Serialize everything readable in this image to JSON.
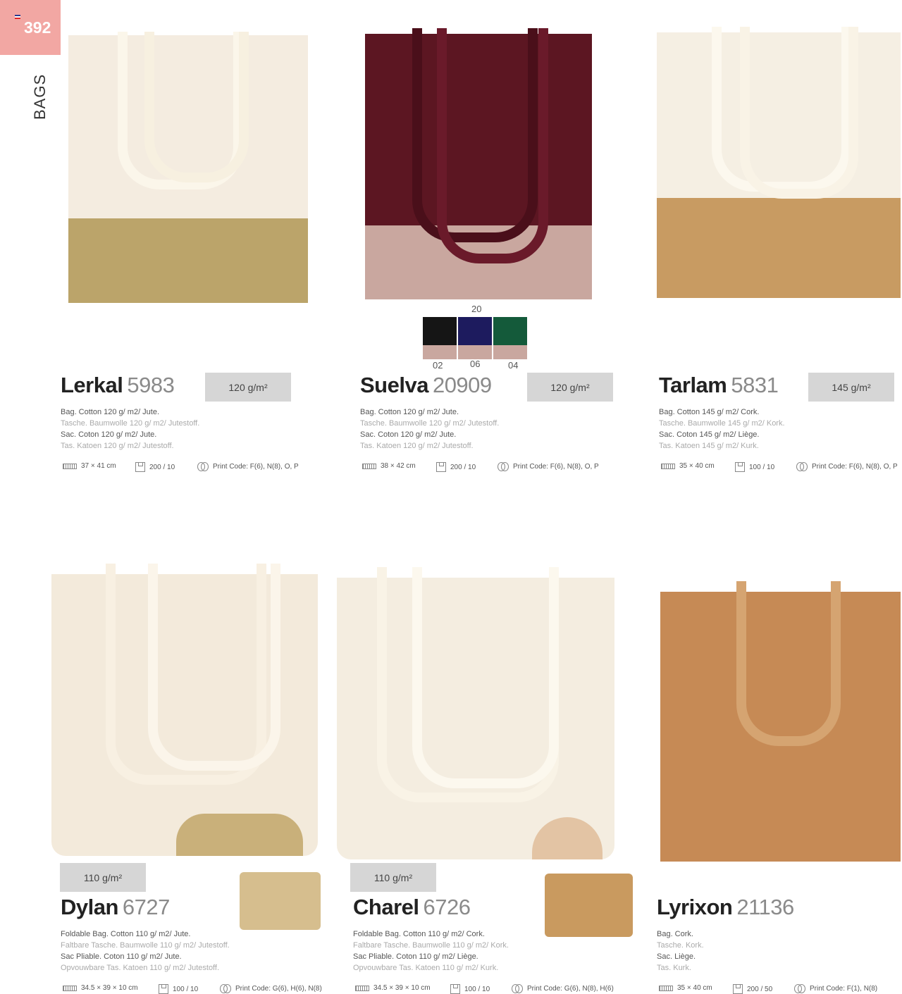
{
  "page": {
    "number": "392",
    "section": "BAGS"
  },
  "colors": {
    "badge": "#f2a7a3",
    "weight_box": "#d6d6d6"
  },
  "products": [
    {
      "name": "Lerkal",
      "code": "5983",
      "weight": "120 g/m²",
      "desc": [
        "Bag. Cotton 120 g/ m2/ Jute.",
        "Tasche. Baumwolle 120 g/ m2/ Jutestoff.",
        "Sac. Coton 120 g/ m2/ Jute.",
        "Tas. Katoen 120 g/ m2/ Jutestoff."
      ],
      "size": "37 × 41 cm",
      "pack": "200 / 10",
      "print": "Print Code: F(6), N(8), O, P"
    },
    {
      "name": "Suelva",
      "code": "20909",
      "weight": "120 g/m²",
      "desc": [
        "Bag. Cotton 120 g/ m2/ Jute.",
        "Tasche. Baumwolle 120 g/ m2/ Jutestoff.",
        "Sac. Coton 120 g/ m2/ Jute.",
        "Tas. Katoen 120 g/ m2/ Jutestoff."
      ],
      "size": "38 × 42 cm",
      "pack": "200 / 10",
      "print": "Print Code: F(6), N(8), O, P",
      "swatches": [
        {
          "code": "20",
          "color": "#5c1622"
        },
        {
          "code": "02",
          "color": "#151515"
        },
        {
          "code": "06",
          "color": "#1d1b5e"
        },
        {
          "code": "04",
          "color": "#145a3a"
        }
      ]
    },
    {
      "name": "Tarlam",
      "code": "5831",
      "weight": "145 g/m²",
      "desc": [
        "Bag. Cotton 145 g/ m2/ Cork.",
        "Tasche. Baumwolle 145 g/ m2/ Kork.",
        "Sac. Coton 145 g/ m2/ Liège.",
        "Tas. Katoen 145 g/ m2/ Kurk."
      ],
      "size": "35 × 40 cm",
      "pack": "100 / 10",
      "print": "Print Code: F(6), N(8), O, P"
    },
    {
      "name": "Dylan",
      "code": "6727",
      "weight": "110 g/m²",
      "desc": [
        "Foldable Bag. Cotton 110 g/ m2/ Jute.",
        "Faltbare Tasche. Baumwolle 110 g/ m2/ Jutestoff.",
        "Sac Pliable. Coton 110 g/ m2/ Jute.",
        "Opvouwbare Tas. Katoen 110 g/ m2/ Jutestoff."
      ],
      "size": "34.5 × 39 × 10 cm",
      "pack": "100 / 10",
      "print": "Print Code: G(6), H(6), N(8)"
    },
    {
      "name": "Charel",
      "code": "6726",
      "weight": "110 g/m²",
      "desc": [
        "Foldable Bag. Cotton 110 g/ m2/ Cork.",
        "Faltbare Tasche. Baumwolle 110 g/ m2/ Kork.",
        "Sac Pliable. Coton 110 g/ m2/ Liège.",
        "Opvouwbare Tas. Katoen 110 g/ m2/ Kurk."
      ],
      "size": "34.5 × 39 × 10 cm",
      "pack": "100 / 10",
      "print": "Print Code: G(6), N(8), H(6)"
    },
    {
      "name": "Lyrixon",
      "code": "21136",
      "desc": [
        "Bag. Cork.",
        "Tasche. Kork.",
        "Sac. Liège.",
        "Tas. Kurk."
      ],
      "size": "35 × 40 cm",
      "pack": "200 / 50",
      "print": "Print Code: F(1), N(8)"
    }
  ]
}
